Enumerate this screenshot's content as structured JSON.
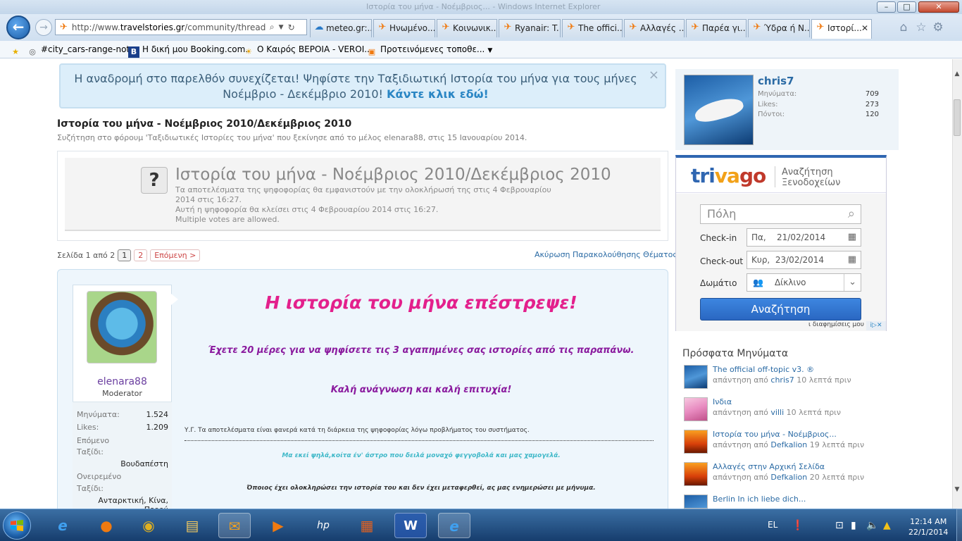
{
  "window": {
    "title": "Ιστορία του μήνα - Νοέμβριος... - Windows Internet Explorer",
    "min": "–",
    "max": "□",
    "close": "✕"
  },
  "browser": {
    "url_prefix": "http://www.",
    "url_domain": "travelstories.gr",
    "url_rest": "/community/threads/%C",
    "tabs": [
      {
        "label": "meteo.gr:..."
      },
      {
        "label": "Ηνωμένο..."
      },
      {
        "label": "Κοινωνικ..."
      },
      {
        "label": "Ryanair: T..."
      },
      {
        "label": "The offici..."
      },
      {
        "label": "Αλλαγές ..."
      },
      {
        "label": "Παρέα γι..."
      },
      {
        "label": "Ύδρα ή Ν..."
      },
      {
        "label": "Ιστορί..."
      }
    ],
    "favorites": [
      {
        "label": "#city_cars-range-note"
      },
      {
        "label": "Η δική μου Booking.com."
      },
      {
        "label": "Ο Καιρός ΒΕΡΟΙΑ - VEROI..."
      },
      {
        "label": "Προτεινόμενες τοποθε..."
      }
    ]
  },
  "notice": {
    "text": "Η αναδρομή στο παρελθόν συνεχίζεται! Ψηφίστε την Ταξιδιωτική Ιστορία του μήνα για τους μήνες Νοέμβριο - Δεκέμβριο 2010!",
    "link": "Κάντε κλικ εδώ!"
  },
  "thread": {
    "title": "Ιστορία του μήνα - Νοέμβριος 2010/Δεκέμβριος 2010",
    "desc": "Συζήτηση στο φόρουμ 'Ταξιδιωτικές Ιστορίες του μήνα' που ξεκίνησε από το μέλος elenara88, στις 15 Ιανουαρίου 2014."
  },
  "poll": {
    "icon": "?",
    "title": "Ιστορία του μήνα - Νοέμβριος 2010/Δεκέμβριος 2010",
    "line1": "Τα αποτελέσματα της ψηφοφορίας θα εμφανιστούν με την ολοκλήρωσή της στις 4 Φεβρουαρίου 2014 στις 16:27.",
    "line2": "Αυτή η ψηφοφορία θα κλείσει στις 4 Φεβρουαρίου 2014 στις 16:27.",
    "line3": "Multiple votes are allowed."
  },
  "pagination": {
    "label": "Σελίδα 1 από 2",
    "p1": "1",
    "p2": "2",
    "next": "Επόμενη >",
    "unwatch": "Ακύρωση Παρακολούθησης Θέματος"
  },
  "poster": {
    "name": "elenara88",
    "role": "Moderator",
    "messages_label": "Μηνύματα:",
    "messages": "1.524",
    "likes_label": "Likes:",
    "likes": "1.209",
    "next_trip_label1": "Επόμενο",
    "next_trip_label2": "Ταξίδι:",
    "next_trip": "Βουδαπέστη",
    "dream_label1": "Ονειρεμένο",
    "dream_label2": "Ταξίδι:",
    "dream": "Ανταρκτική, Κίνα, Περού"
  },
  "post": {
    "heading": "Η ιστορία του μήνα επέστρεψε!",
    "line1": "Έχετε 20 μέρες για να ψηφίσετε τις 3 αγαπημένες σας ιστορίες από τις παραπάνω.",
    "line2": "Καλή ανάγνωση και καλή επιτυχία!",
    "note": "Υ.Γ. Τα αποτελέσματα είναι φανερά κατά τη διάρκεια της ψηφοφορίας λόγω προβλήματος του συστήματος.",
    "quote": "Μα εκεί ψηλά,κοίτα έν' άστρο που δειλά μοναχό φεγγοβολά και μας χαμογελά.",
    "final": "Όποιος έχει ολοκληρώσει την ιστορία του και δεν έχει μεταφερθεί, ας μας ενημερώσει με μήνυμα."
  },
  "sidebar": {
    "user": {
      "name": "chris7",
      "messages_label": "Μηνύματα:",
      "messages": "709",
      "likes_label": "Likes:",
      "likes": "273",
      "points_label": "Πόντοι:",
      "points": "120"
    },
    "trivago": {
      "logo_tri": "tri",
      "logo_va": "va",
      "logo_go": "go",
      "tagline1": "Αναζήτηση",
      "tagline2": "Ξενοδοχείων",
      "city_placeholder": "Πόλη",
      "checkin_label": "Check-in",
      "checkin_value": "Πα,    21/02/2014",
      "checkout_label": "Check-out",
      "checkout_value": "Κυρ,  23/02/2014",
      "room_label": "Δωμάτιο",
      "room_value": "Δίκλινο",
      "search": "Αναζήτηση",
      "ad": "ι διαφημίσεις μου",
      "adicon": "i▷✕"
    },
    "recent_heading": "Πρόσφατα Μηνύματα",
    "recent": [
      {
        "title": "The official off-topic v3. ®",
        "prefix": "απάντηση από ",
        "user": "chris7",
        "time": " 10 λεπτά πριν"
      },
      {
        "title": "Ινδια",
        "prefix": "απάντηση από ",
        "user": "villi",
        "time": " 10 λεπτά πριν"
      },
      {
        "title": "Ιστορία του μήνα - Νοέμβριος...",
        "prefix": "απάντηση από ",
        "user": "Defkalion",
        "time": " 19 λεπτά πριν"
      },
      {
        "title": "Αλλαγές στην Αρχική Σελίδα",
        "prefix": "απάντηση από ",
        "user": "Defkalion",
        "time": " 20 λεπτά πριν"
      },
      {
        "title": "Berlin In ich liebe dich...",
        "prefix": "",
        "user": "",
        "time": ""
      }
    ]
  },
  "taskbar": {
    "lang": "EL",
    "time": "12:14 AM",
    "date": "22/1/2014"
  },
  "colors": {
    "accent": "#2a86c4",
    "heading_pink": "#e3208c",
    "purple": "#8a1a9e",
    "trivago_blue": "#2f66b1"
  }
}
